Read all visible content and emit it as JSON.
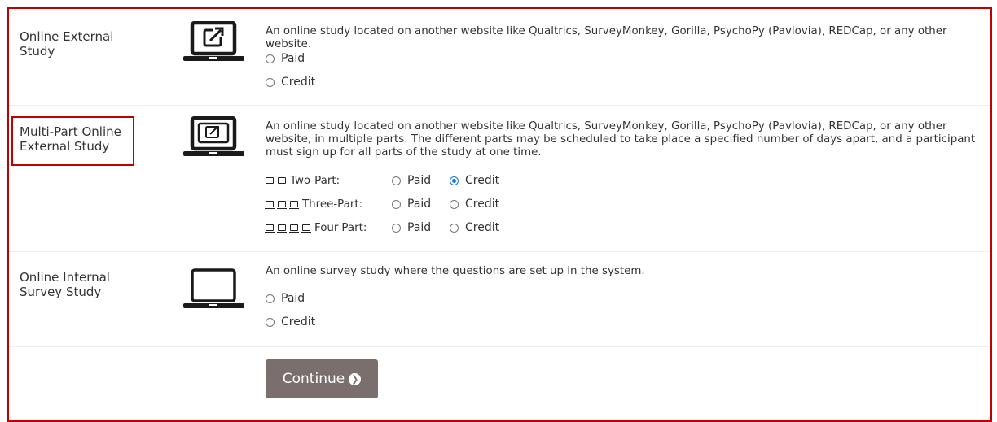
{
  "studies": [
    {
      "label": "Online External Study",
      "icon": "laptop-external-link-icon",
      "description": "An online study located on another website like Qualtrics, SurveyMonkey, Gorilla, PsychoPy (Pavlovia), REDCap, or any other website.",
      "options": [
        {
          "label": "Paid",
          "checked": false
        },
        {
          "label": "Credit",
          "checked": false
        }
      ]
    },
    {
      "label": "Multi-Part Online External Study",
      "icon": "laptop-multi-external-icon",
      "description": "An online study located on another website like Qualtrics, SurveyMonkey, Gorilla, PsychoPy (Pavlovia), REDCap, or any other website, in multiple parts. The different parts may be scheduled to take place a specified number of days apart, and a participant must sign up for all parts of the study at one time.",
      "parts": [
        {
          "label": "Two-Part:",
          "icon_count": 2,
          "paid": {
            "label": "Paid",
            "checked": false
          },
          "credit": {
            "label": "Credit",
            "checked": true
          }
        },
        {
          "label": "Three-Part:",
          "icon_count": 3,
          "paid": {
            "label": "Paid",
            "checked": false
          },
          "credit": {
            "label": "Credit",
            "checked": false
          }
        },
        {
          "label": "Four-Part:",
          "icon_count": 4,
          "paid": {
            "label": "Paid",
            "checked": false
          },
          "credit": {
            "label": "Credit",
            "checked": false
          }
        }
      ]
    },
    {
      "label": "Online Internal Survey Study",
      "icon": "laptop-icon",
      "description": "An online survey study where the questions are set up in the system.",
      "options": [
        {
          "label": "Paid",
          "checked": false
        },
        {
          "label": "Credit",
          "checked": false
        }
      ]
    }
  ],
  "continue_button": {
    "label": "Continue",
    "icon": "chevron-circle-right-icon"
  },
  "colors": {
    "highlight": "#c00000",
    "button_bg": "#7a6f6d",
    "radio_checked": "#1a73e8"
  }
}
